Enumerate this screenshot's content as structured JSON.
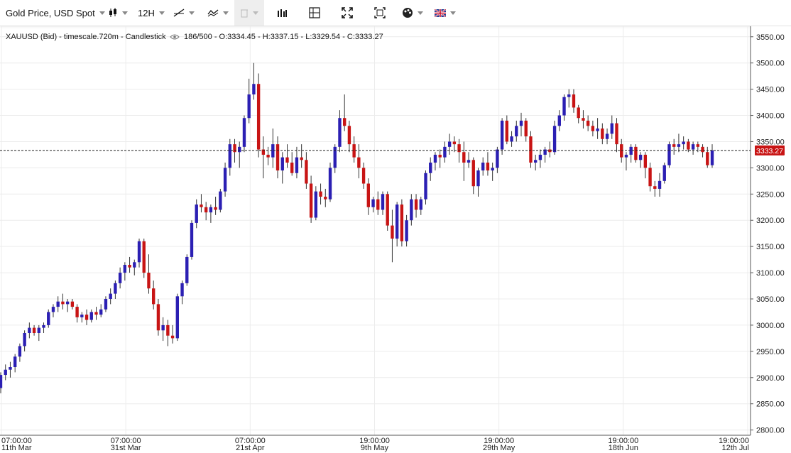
{
  "toolbar": {
    "instrument": "Gold Price, USD Spot",
    "timeframe": "12H"
  },
  "info": {
    "symbol_text": "XAUUSD (Bid) - timescale.720m - Candlestick",
    "counter_text": "186/500 - O:3334.45 - H:3337.15 - L:3329.54 - C:3333.27"
  },
  "colors": {
    "up": "#2b1fb3",
    "down": "#c81414",
    "grid": "#ececec",
    "price_label_bg": "#c81414"
  },
  "chart_data": {
    "type": "candlestick",
    "ylim": [
      2790,
      3570
    ],
    "y_ticks": [
      "3550.00",
      "3500.00",
      "3450.00",
      "3400.00",
      "3350.00",
      "3300.00",
      "3250.00",
      "3200.00",
      "3150.00",
      "3100.00",
      "3050.00",
      "3000.00",
      "2950.00",
      "2900.00",
      "2850.00",
      "2800.00"
    ],
    "x_labels": [
      {
        "time": "07:00:00",
        "date": "11th Mar"
      },
      {
        "time": "07:00:00",
        "date": "31st Mar"
      },
      {
        "time": "07:00:00",
        "date": "21st Apr"
      },
      {
        "time": "19:00:00",
        "date": "9th May"
      },
      {
        "time": "19:00:00",
        "date": "29th May"
      },
      {
        "time": "19:00:00",
        "date": "18th Jun"
      },
      {
        "time": "19:00:00",
        "date": "12th Jul"
      }
    ],
    "last_price": 3333.27,
    "last_price_label": "3333.27",
    "candles": [
      [
        2880,
        2910,
        2870,
        2905
      ],
      [
        2905,
        2925,
        2895,
        2915
      ],
      [
        2915,
        2930,
        2900,
        2920
      ],
      [
        2920,
        2945,
        2910,
        2940
      ],
      [
        2940,
        2965,
        2930,
        2960
      ],
      [
        2960,
        2990,
        2950,
        2985
      ],
      [
        2985,
        3005,
        2975,
        2995
      ],
      [
        2995,
        3000,
        2980,
        2985
      ],
      [
        2985,
        3000,
        2970,
        2995
      ],
      [
        2995,
        3005,
        2985,
        3000
      ],
      [
        3000,
        3030,
        2995,
        3025
      ],
      [
        3025,
        3040,
        3015,
        3035
      ],
      [
        3035,
        3055,
        3025,
        3045
      ],
      [
        3045,
        3060,
        3030,
        3040
      ],
      [
        3040,
        3050,
        3025,
        3045
      ],
      [
        3045,
        3050,
        3030,
        3035
      ],
      [
        3035,
        3040,
        3005,
        3015
      ],
      [
        3015,
        3025,
        3005,
        3020
      ],
      [
        3020,
        3030,
        3000,
        3010
      ],
      [
        3010,
        3030,
        3005,
        3025
      ],
      [
        3025,
        3035,
        3010,
        3020
      ],
      [
        3020,
        3040,
        3015,
        3030
      ],
      [
        3030,
        3055,
        3025,
        3050
      ],
      [
        3050,
        3070,
        3040,
        3060
      ],
      [
        3060,
        3085,
        3050,
        3080
      ],
      [
        3080,
        3110,
        3070,
        3100
      ],
      [
        3100,
        3120,
        3085,
        3115
      ],
      [
        3115,
        3130,
        3100,
        3110
      ],
      [
        3110,
        3125,
        3095,
        3120
      ],
      [
        3120,
        3165,
        3110,
        3160
      ],
      [
        3160,
        3165,
        3090,
        3100
      ],
      [
        3100,
        3135,
        3060,
        3070
      ],
      [
        3070,
        3085,
        3030,
        3040
      ],
      [
        3040,
        3050,
        2980,
        2990
      ],
      [
        2990,
        3015,
        2970,
        3000
      ],
      [
        3000,
        3010,
        2960,
        2980
      ],
      [
        2980,
        3000,
        2965,
        2975
      ],
      [
        2975,
        3060,
        2970,
        3055
      ],
      [
        3055,
        3085,
        3040,
        3080
      ],
      [
        3080,
        3135,
        3075,
        3130
      ],
      [
        3130,
        3200,
        3125,
        3195
      ],
      [
        3195,
        3240,
        3185,
        3230
      ],
      [
        3230,
        3250,
        3215,
        3225
      ],
      [
        3225,
        3235,
        3200,
        3215
      ],
      [
        3215,
        3230,
        3195,
        3225
      ],
      [
        3225,
        3245,
        3210,
        3220
      ],
      [
        3220,
        3260,
        3215,
        3255
      ],
      [
        3255,
        3310,
        3245,
        3300
      ],
      [
        3300,
        3355,
        3285,
        3345
      ],
      [
        3345,
        3355,
        3310,
        3330
      ],
      [
        3330,
        3350,
        3300,
        3340
      ],
      [
        3340,
        3400,
        3330,
        3395
      ],
      [
        3395,
        3470,
        3385,
        3440
      ],
      [
        3440,
        3500,
        3430,
        3460
      ],
      [
        3460,
        3480,
        3320,
        3335
      ],
      [
        3335,
        3360,
        3280,
        3325
      ],
      [
        3325,
        3340,
        3305,
        3320
      ],
      [
        3320,
        3375,
        3300,
        3345
      ],
      [
        3345,
        3360,
        3280,
        3295
      ],
      [
        3295,
        3330,
        3270,
        3320
      ],
      [
        3320,
        3345,
        3300,
        3310
      ],
      [
        3310,
        3330,
        3285,
        3290
      ],
      [
        3290,
        3340,
        3280,
        3320
      ],
      [
        3320,
        3345,
        3300,
        3315
      ],
      [
        3315,
        3330,
        3260,
        3270
      ],
      [
        3270,
        3285,
        3195,
        3205
      ],
      [
        3205,
        3265,
        3200,
        3255
      ],
      [
        3255,
        3270,
        3230,
        3245
      ],
      [
        3245,
        3260,
        3225,
        3240
      ],
      [
        3240,
        3310,
        3235,
        3300
      ],
      [
        3300,
        3345,
        3290,
        3340
      ],
      [
        3340,
        3410,
        3330,
        3395
      ],
      [
        3395,
        3440,
        3370,
        3380
      ],
      [
        3380,
        3390,
        3330,
        3345
      ],
      [
        3345,
        3360,
        3310,
        3320
      ],
      [
        3320,
        3345,
        3280,
        3300
      ],
      [
        3300,
        3310,
        3260,
        3270
      ],
      [
        3270,
        3280,
        3210,
        3225
      ],
      [
        3225,
        3245,
        3215,
        3240
      ],
      [
        3240,
        3255,
        3210,
        3220
      ],
      [
        3220,
        3255,
        3210,
        3250
      ],
      [
        3250,
        3255,
        3180,
        3190
      ],
      [
        3190,
        3220,
        3120,
        3165
      ],
      [
        3165,
        3235,
        3150,
        3230
      ],
      [
        3230,
        3240,
        3150,
        3160
      ],
      [
        3160,
        3210,
        3150,
        3200
      ],
      [
        3200,
        3250,
        3190,
        3240
      ],
      [
        3240,
        3250,
        3205,
        3220
      ],
      [
        3220,
        3245,
        3210,
        3240
      ],
      [
        3240,
        3295,
        3230,
        3290
      ],
      [
        3290,
        3320,
        3275,
        3310
      ],
      [
        3310,
        3330,
        3295,
        3325
      ],
      [
        3325,
        3335,
        3300,
        3320
      ],
      [
        3320,
        3350,
        3310,
        3340
      ],
      [
        3340,
        3365,
        3325,
        3350
      ],
      [
        3350,
        3360,
        3330,
        3345
      ],
      [
        3345,
        3355,
        3310,
        3330
      ],
      [
        3330,
        3350,
        3275,
        3310
      ],
      [
        3310,
        3330,
        3300,
        3315
      ],
      [
        3315,
        3320,
        3250,
        3265
      ],
      [
        3265,
        3300,
        3245,
        3295
      ],
      [
        3295,
        3320,
        3285,
        3310
      ],
      [
        3310,
        3330,
        3285,
        3295
      ],
      [
        3295,
        3310,
        3275,
        3300
      ],
      [
        3300,
        3340,
        3290,
        3335
      ],
      [
        3335,
        3395,
        3325,
        3390
      ],
      [
        3390,
        3400,
        3345,
        3350
      ],
      [
        3350,
        3370,
        3340,
        3360
      ],
      [
        3360,
        3390,
        3350,
        3380
      ],
      [
        3380,
        3405,
        3360,
        3390
      ],
      [
        3390,
        3395,
        3350,
        3360
      ],
      [
        3360,
        3370,
        3300,
        3310
      ],
      [
        3310,
        3325,
        3295,
        3315
      ],
      [
        3315,
        3335,
        3300,
        3325
      ],
      [
        3325,
        3340,
        3310,
        3335
      ],
      [
        3335,
        3350,
        3320,
        3330
      ],
      [
        3330,
        3390,
        3325,
        3380
      ],
      [
        3380,
        3410,
        3370,
        3400
      ],
      [
        3400,
        3440,
        3390,
        3435
      ],
      [
        3435,
        3450,
        3415,
        3440
      ],
      [
        3440,
        3450,
        3405,
        3415
      ],
      [
        3415,
        3420,
        3385,
        3395
      ],
      [
        3395,
        3410,
        3375,
        3390
      ],
      [
        3390,
        3400,
        3370,
        3380
      ],
      [
        3380,
        3390,
        3360,
        3370
      ],
      [
        3370,
        3395,
        3355,
        3375
      ],
      [
        3375,
        3385,
        3345,
        3355
      ],
      [
        3355,
        3375,
        3345,
        3365
      ],
      [
        3365,
        3400,
        3355,
        3385
      ],
      [
        3385,
        3395,
        3330,
        3345
      ],
      [
        3345,
        3355,
        3310,
        3320
      ],
      [
        3320,
        3330,
        3295,
        3325
      ],
      [
        3325,
        3345,
        3310,
        3340
      ],
      [
        3340,
        3345,
        3310,
        3315
      ],
      [
        3315,
        3330,
        3300,
        3325
      ],
      [
        3325,
        3330,
        3280,
        3300
      ],
      [
        3300,
        3310,
        3255,
        3265
      ],
      [
        3265,
        3275,
        3245,
        3260
      ],
      [
        3260,
        3290,
        3245,
        3275
      ],
      [
        3275,
        3310,
        3270,
        3305
      ],
      [
        3305,
        3350,
        3300,
        3345
      ],
      [
        3345,
        3355,
        3325,
        3340
      ],
      [
        3340,
        3365,
        3330,
        3345
      ],
      [
        3345,
        3360,
        3335,
        3350
      ],
      [
        3350,
        3355,
        3330,
        3335
      ],
      [
        3335,
        3350,
        3325,
        3345
      ],
      [
        3345,
        3350,
        3330,
        3340
      ],
      [
        3340,
        3345,
        3320,
        3330
      ],
      [
        3330,
        3340,
        3300,
        3305
      ],
      [
        3305,
        3345,
        3300,
        3333.27
      ]
    ]
  }
}
